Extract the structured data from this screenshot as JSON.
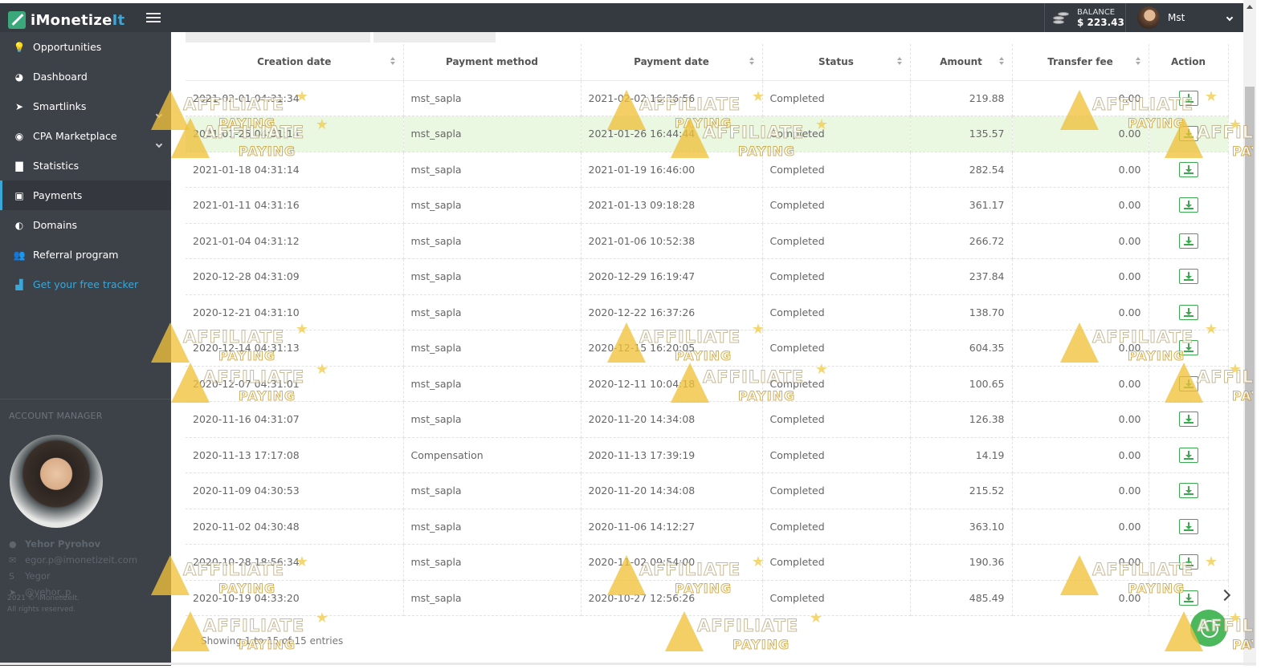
{
  "app": {
    "logo_main": "iMonetize",
    "logo_accent": "It"
  },
  "header": {
    "balance_label": "BALANCE",
    "balance_value": "$ 223.43",
    "user_name": "Mst"
  },
  "sidebar": {
    "items": [
      {
        "label": "Opportunities",
        "icon": "lightbulb-icon",
        "glyph": "💡"
      },
      {
        "label": "Dashboard",
        "icon": "dashboard-icon",
        "glyph": "◕"
      },
      {
        "label": "Smartlinks",
        "icon": "paper-plane-icon",
        "glyph": "➤"
      },
      {
        "label": "CPA Marketplace",
        "icon": "cpa-icon",
        "glyph": "◉"
      },
      {
        "label": "Statistics",
        "icon": "bar-chart-icon",
        "glyph": "▇"
      },
      {
        "label": "Payments",
        "icon": "money-icon",
        "glyph": "▣"
      },
      {
        "label": "Domains",
        "icon": "globe-icon",
        "glyph": "◐"
      },
      {
        "label": "Referral program",
        "icon": "users-icon",
        "glyph": "👥"
      },
      {
        "label": "Get your free tracker",
        "icon": "tracker-icon",
        "glyph": "▟"
      }
    ],
    "account_manager": {
      "title": "ACCOUNT MANAGER",
      "name": "Yehor Pyrohov",
      "email": "egor.p@imonetizeit.com",
      "skype": "Yegor",
      "telegram": "@yehor_p"
    },
    "copyright_line1": "2021 © iMonetizeIt.",
    "copyright_line2": "All rights reserved."
  },
  "table": {
    "columns": [
      "Creation date",
      "Payment method",
      "Payment date",
      "Status",
      "Amount",
      "Transfer fee",
      "Action"
    ],
    "rows": [
      {
        "creation": "2021-02-01 04:31:34",
        "method": "mst_sapla",
        "paid": "2021-02-02 16:26:56",
        "status": "Completed",
        "amount": "219.88",
        "fee": "0.00"
      },
      {
        "creation": "2021-01-25 04:31:14",
        "method": "mst_sapla",
        "paid": "2021-01-26 16:44:44",
        "status": "Completed",
        "amount": "135.57",
        "fee": "0.00"
      },
      {
        "creation": "2021-01-18 04:31:14",
        "method": "mst_sapla",
        "paid": "2021-01-19 16:46:00",
        "status": "Completed",
        "amount": "282.54",
        "fee": "0.00"
      },
      {
        "creation": "2021-01-11 04:31:16",
        "method": "mst_sapla",
        "paid": "2021-01-13 09:18:28",
        "status": "Completed",
        "amount": "361.17",
        "fee": "0.00"
      },
      {
        "creation": "2021-01-04 04:31:12",
        "method": "mst_sapla",
        "paid": "2021-01-06 10:52:38",
        "status": "Completed",
        "amount": "266.72",
        "fee": "0.00"
      },
      {
        "creation": "2020-12-28 04:31:09",
        "method": "mst_sapla",
        "paid": "2020-12-29 16:19:47",
        "status": "Completed",
        "amount": "237.84",
        "fee": "0.00"
      },
      {
        "creation": "2020-12-21 04:31:10",
        "method": "mst_sapla",
        "paid": "2020-12-22 16:37:26",
        "status": "Completed",
        "amount": "138.70",
        "fee": "0.00"
      },
      {
        "creation": "2020-12-14 04:31:13",
        "method": "mst_sapla",
        "paid": "2020-12-15 16:20:05",
        "status": "Completed",
        "amount": "604.35",
        "fee": "0.00"
      },
      {
        "creation": "2020-12-07 04:31:01",
        "method": "mst_sapla",
        "paid": "2020-12-11 10:04:18",
        "status": "Completed",
        "amount": "100.65",
        "fee": "0.00"
      },
      {
        "creation": "2020-11-16 04:31:07",
        "method": "mst_sapla",
        "paid": "2020-11-20 14:34:08",
        "status": "Completed",
        "amount": "126.38",
        "fee": "0.00"
      },
      {
        "creation": "2020-11-13 17:17:08",
        "method": "Compensation",
        "paid": "2020-11-13 17:39:19",
        "status": "Completed",
        "amount": "14.19",
        "fee": "0.00"
      },
      {
        "creation": "2020-11-09 04:30:53",
        "method": "mst_sapla",
        "paid": "2020-11-20 14:34:08",
        "status": "Completed",
        "amount": "215.52",
        "fee": "0.00"
      },
      {
        "creation": "2020-11-02 04:30:48",
        "method": "mst_sapla",
        "paid": "2020-11-06 14:12:27",
        "status": "Completed",
        "amount": "363.10",
        "fee": "0.00"
      },
      {
        "creation": "2020-10-28 18:56:34",
        "method": "mst_sapla",
        "paid": "2020-11-02 09:54:00",
        "status": "Completed",
        "amount": "190.36",
        "fee": "0.00"
      },
      {
        "creation": "2020-10-19 04:33:20",
        "method": "mst_sapla",
        "paid": "2020-10-27 12:56:26",
        "status": "Completed",
        "amount": "485.49",
        "fee": "0.00"
      }
    ],
    "highlighted_row": 1,
    "footer": "Showing 1 to 15 of 15 entries"
  },
  "watermark": {
    "line1": "AFFILIATE",
    "line2": "PAYING"
  },
  "colors": {
    "sidebar_bg": "#3d4148",
    "topbar_bg": "#353a40",
    "accent": "#3aa7d9",
    "success": "#3ba94d",
    "highlight_row": "#eaf7e1"
  }
}
